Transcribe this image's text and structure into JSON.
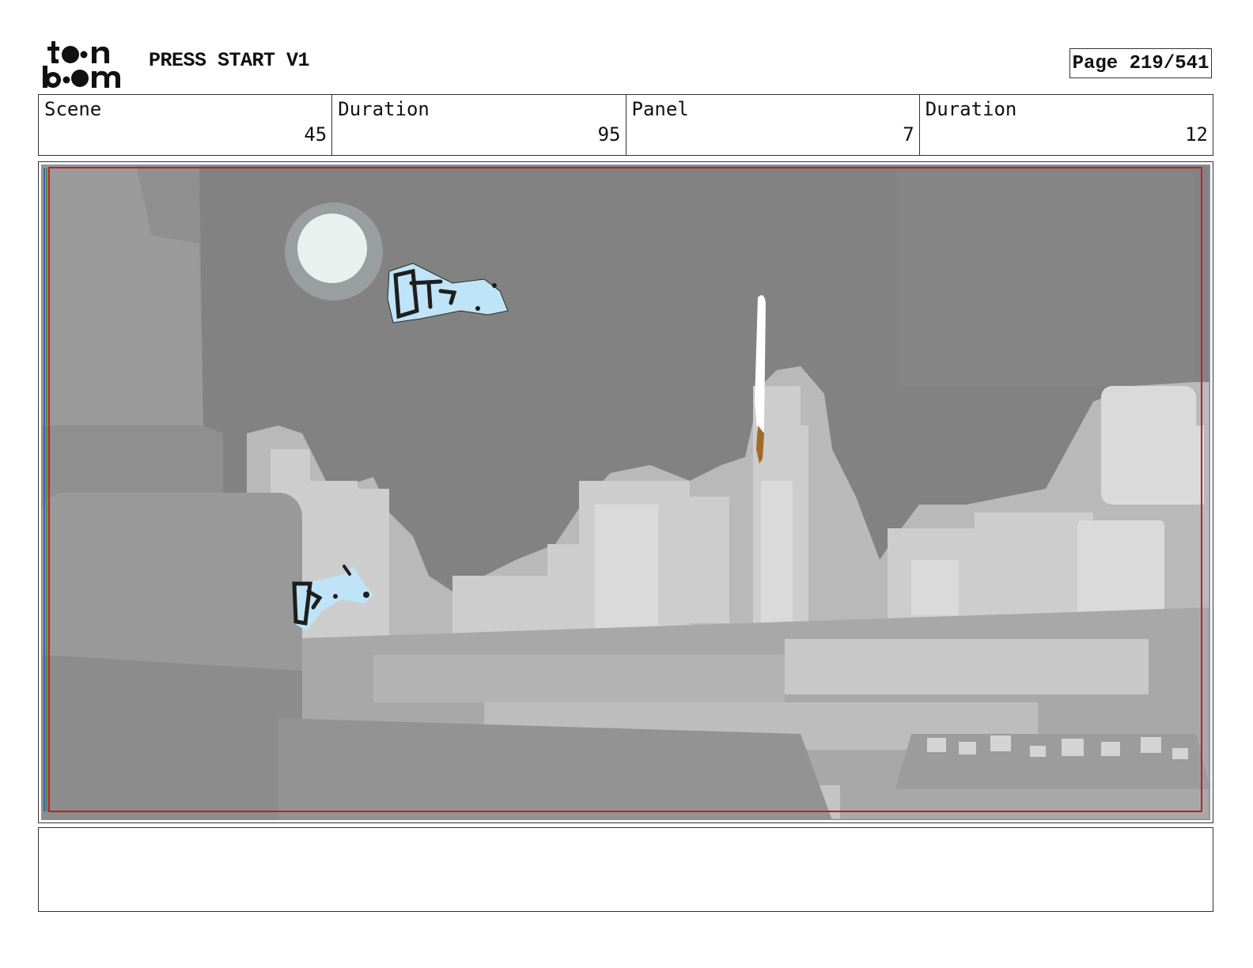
{
  "header": {
    "logo_text": "toon boom",
    "project_title": "PRESS START V1",
    "page_label": "Page 219/541"
  },
  "info": {
    "scene_label": "Scene",
    "scene_value": "45",
    "scene_duration_label": "Duration",
    "scene_duration_value": "95",
    "panel_label": "Panel",
    "panel_value": "7",
    "panel_duration_label": "Duration",
    "panel_duration_value": "12"
  },
  "notes": {
    "text": ""
  }
}
